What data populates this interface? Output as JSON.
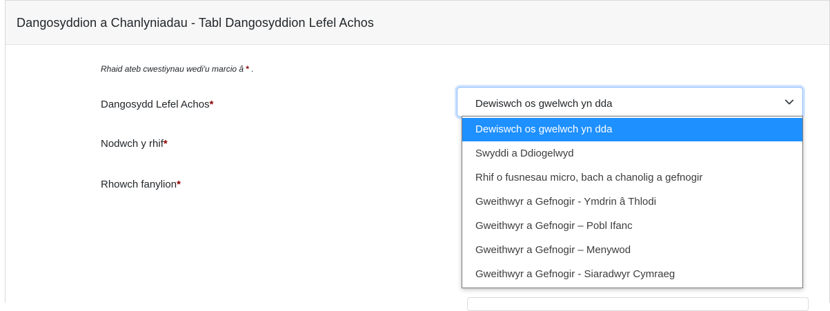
{
  "card": {
    "title": "Dangosyddion a Chanlyniadau - Tabl Dangosyddion Lefel Achos"
  },
  "form": {
    "required_note_text": "Rhaid ateb cwestiynau wedi'u marcio â",
    "required_marker": "*",
    "required_note_end": ".",
    "fields": [
      {
        "label": "Dangosydd Lefel Achos",
        "marker": "*"
      },
      {
        "label": "Nodwch y rhif",
        "marker": "*"
      },
      {
        "label": "Rhowch fanylion",
        "marker": "*"
      }
    ],
    "select": {
      "value": "Dewiswch os gwelwch yn dda",
      "icon": "chevron-down-icon",
      "options": [
        "Dewiswch os gwelwch yn dda",
        "Swyddi a Ddiogelwyd",
        "Rhif o fusnesau micro, bach a chanolig a gefnogir",
        "Gweithwyr a Gefnogir - Ymdrin â Thlodi",
        "Gweithwyr a Gefnogir – Pobl Ifanc",
        "Gweithwyr a Gefnogir – Menywod",
        "Gweithwyr a Gefnogir - Siaradwyr Cymraeg"
      ],
      "selected_index": 0
    }
  },
  "colors": {
    "required": "#8b0000",
    "highlight": "#1e90ff",
    "focus_border": "#86b7fe"
  }
}
